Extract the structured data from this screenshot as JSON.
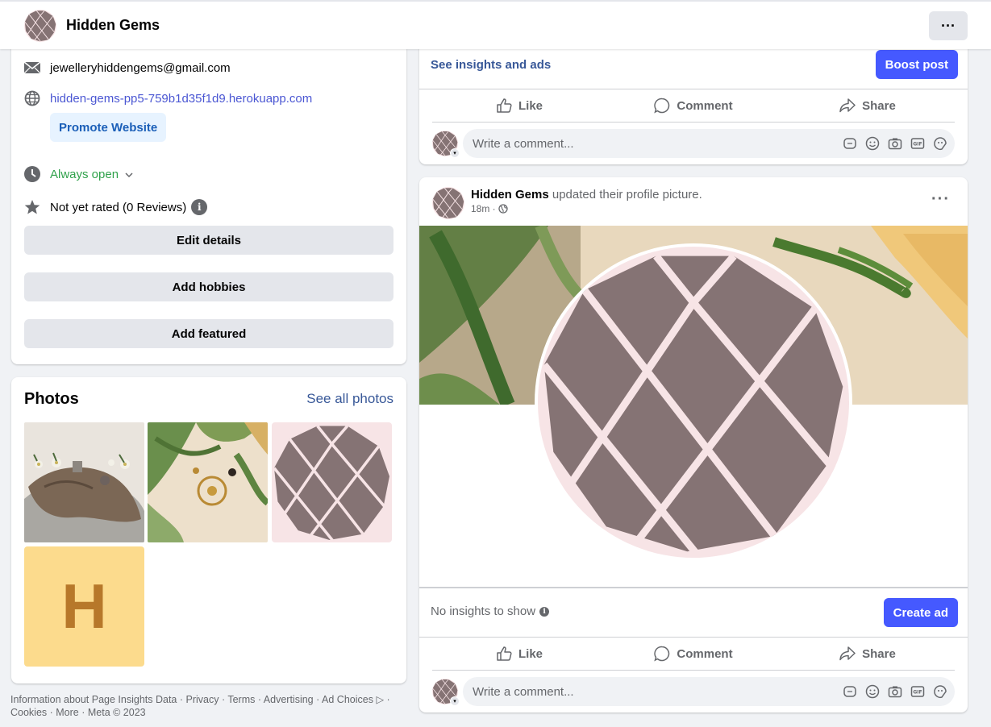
{
  "header": {
    "page_name": "Hidden Gems",
    "more_label": "···"
  },
  "intro": {
    "email": "jewelleryhiddengems@gmail.com",
    "website": "hidden-gems-pp5-759b1d35f1d9.herokuapp.com",
    "promote_label": "Promote Website",
    "hours": "Always open",
    "rating": "Not yet rated (0 Reviews)",
    "buttons": [
      "Edit details",
      "Add hobbies",
      "Add featured"
    ]
  },
  "photos": {
    "title": "Photos",
    "see_all": "See all photos",
    "letter_tile": "H"
  },
  "footer": {
    "text": "Information about Page Insights Data · Privacy · Terms · Advertising · Ad Choices ▷ · Cookies · More · Meta © 2023"
  },
  "post_top": {
    "insights_link": "See insights and ads",
    "boost_label": "Boost post"
  },
  "actions": {
    "like": "Like",
    "comment": "Comment",
    "share": "Share"
  },
  "comment": {
    "placeholder": "Write a comment..."
  },
  "post_main": {
    "author": "Hidden Gems",
    "activity": "updated their profile picture.",
    "time": "18m ·",
    "no_insights": "No insights to show",
    "create_ad_label": "Create ad"
  },
  "colors": {
    "accent": "#4559ff",
    "link": "#385898",
    "green": "#31a24c",
    "logo_fill": "#857374",
    "logo_bg": "#f7e4e6"
  }
}
